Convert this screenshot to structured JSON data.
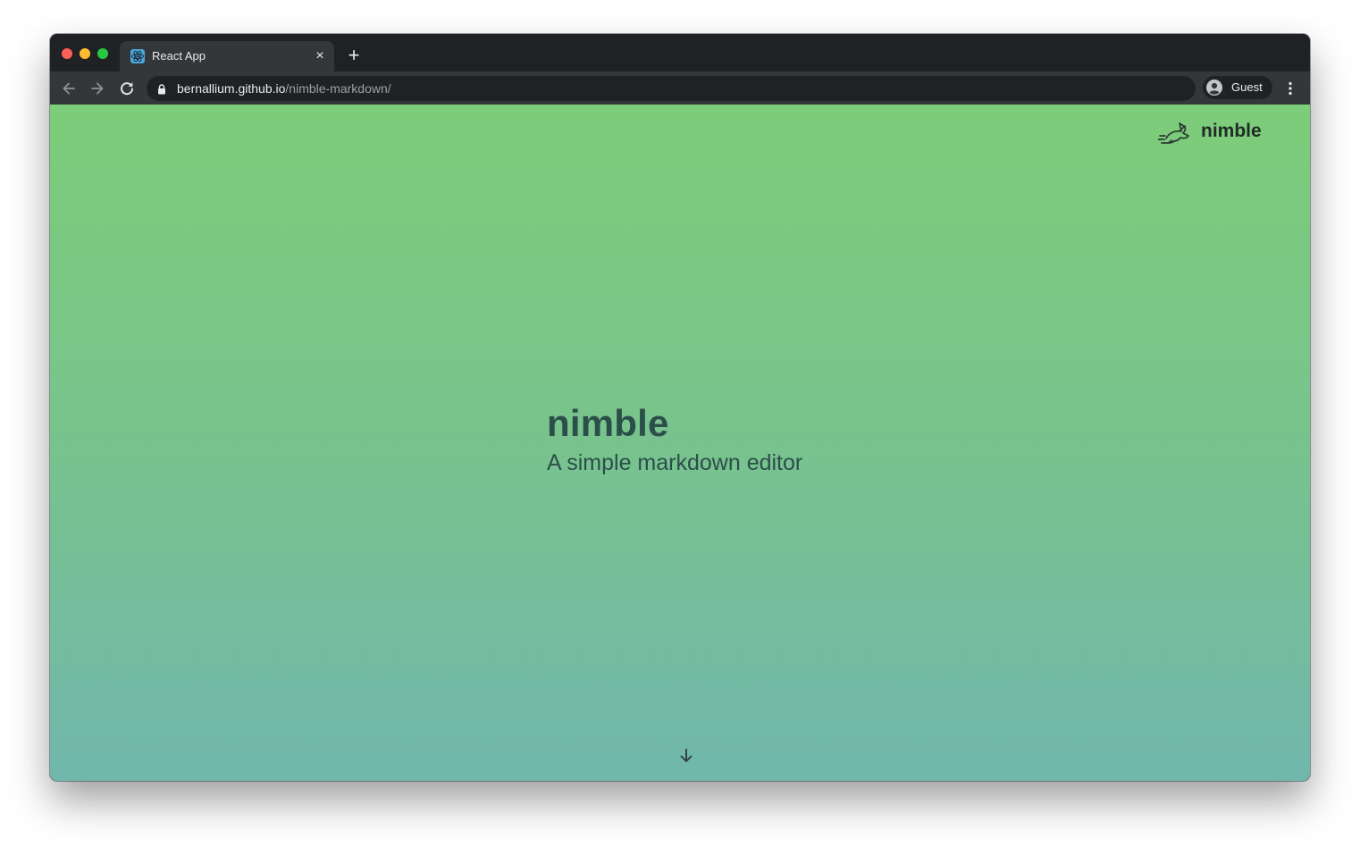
{
  "browser": {
    "tab": {
      "title": "React App",
      "favicon": "react-icon",
      "close": "×"
    },
    "new_tab": "+",
    "address": {
      "host": "bernallium.github.io",
      "path": "/nimble-markdown/"
    },
    "profile": {
      "label": "Guest"
    }
  },
  "page": {
    "brand": {
      "name": "nimble",
      "icon": "rabbit-icon"
    },
    "hero": {
      "title": "nimble",
      "subtitle": "A simple markdown editor"
    },
    "scroll_icon": "arrow-down-icon",
    "colors": {
      "gradient_top": "#7ccd7a",
      "gradient_bottom": "#70b7ac",
      "heading": "#2c4e4a"
    }
  }
}
